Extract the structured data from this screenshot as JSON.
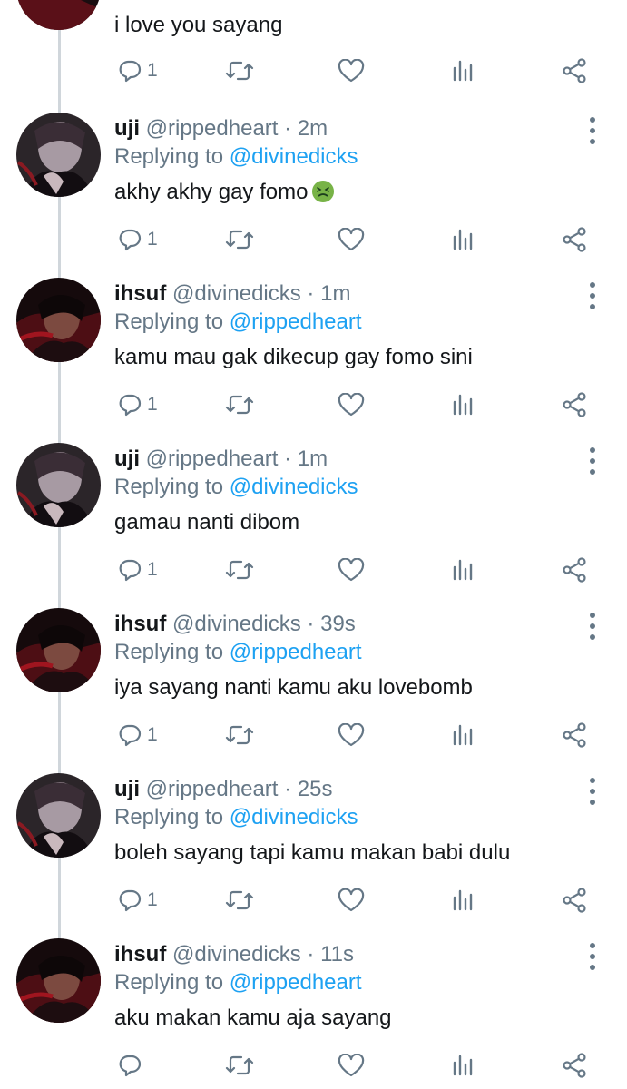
{
  "theme": {
    "text": "#14171a",
    "muted": "#657786",
    "link": "#1da1f2",
    "line": "#d0d6db"
  },
  "top_tweet": {
    "text": "i love you sayang",
    "reply_count": "1"
  },
  "tweets": [
    {
      "name": "uji",
      "handle": "@rippedheart",
      "dot": "·",
      "time": "2m",
      "replying_label": "Replying to",
      "replying_to": "@divinedicks",
      "text": "akhy akhy gay fomo",
      "emoji": "nauseated-face",
      "reply_count": "1",
      "avatar": "uji-avatar"
    },
    {
      "name": "ihsuf",
      "handle": "@divinedicks",
      "dot": "·",
      "time": "1m",
      "replying_label": "Replying to",
      "replying_to": "@rippedheart",
      "text": "kamu mau gak dikecup gay fomo sini",
      "reply_count": "1",
      "avatar": "ihsuf-avatar"
    },
    {
      "name": "uji",
      "handle": "@rippedheart",
      "dot": "·",
      "time": "1m",
      "replying_label": "Replying to",
      "replying_to": "@divinedicks",
      "text": "gamau nanti dibom",
      "reply_count": "1",
      "avatar": "uji-avatar"
    },
    {
      "name": "ihsuf",
      "handle": "@divinedicks",
      "dot": "·",
      "time": "39s",
      "replying_label": "Replying to",
      "replying_to": "@rippedheart",
      "text": "iya sayang nanti kamu aku lovebomb",
      "reply_count": "1",
      "avatar": "ihsuf-avatar"
    },
    {
      "name": "uji",
      "handle": "@rippedheart",
      "dot": "·",
      "time": "25s",
      "replying_label": "Replying to",
      "replying_to": "@divinedicks",
      "text": "boleh sayang tapi kamu makan babi dulu",
      "reply_count": "1",
      "avatar": "uji-avatar"
    },
    {
      "name": "ihsuf",
      "handle": "@divinedicks",
      "dot": "·",
      "time": "11s",
      "replying_label": "Replying to",
      "replying_to": "@rippedheart",
      "text": "aku makan kamu aja sayang",
      "reply_count": "",
      "avatar": "ihsuf-avatar"
    }
  ],
  "icons": {
    "reply": "reply-icon",
    "retweet": "retweet-icon",
    "like": "heart-icon",
    "stats": "analytics-icon",
    "share": "share-icon",
    "more": "more-vertical-icon"
  }
}
